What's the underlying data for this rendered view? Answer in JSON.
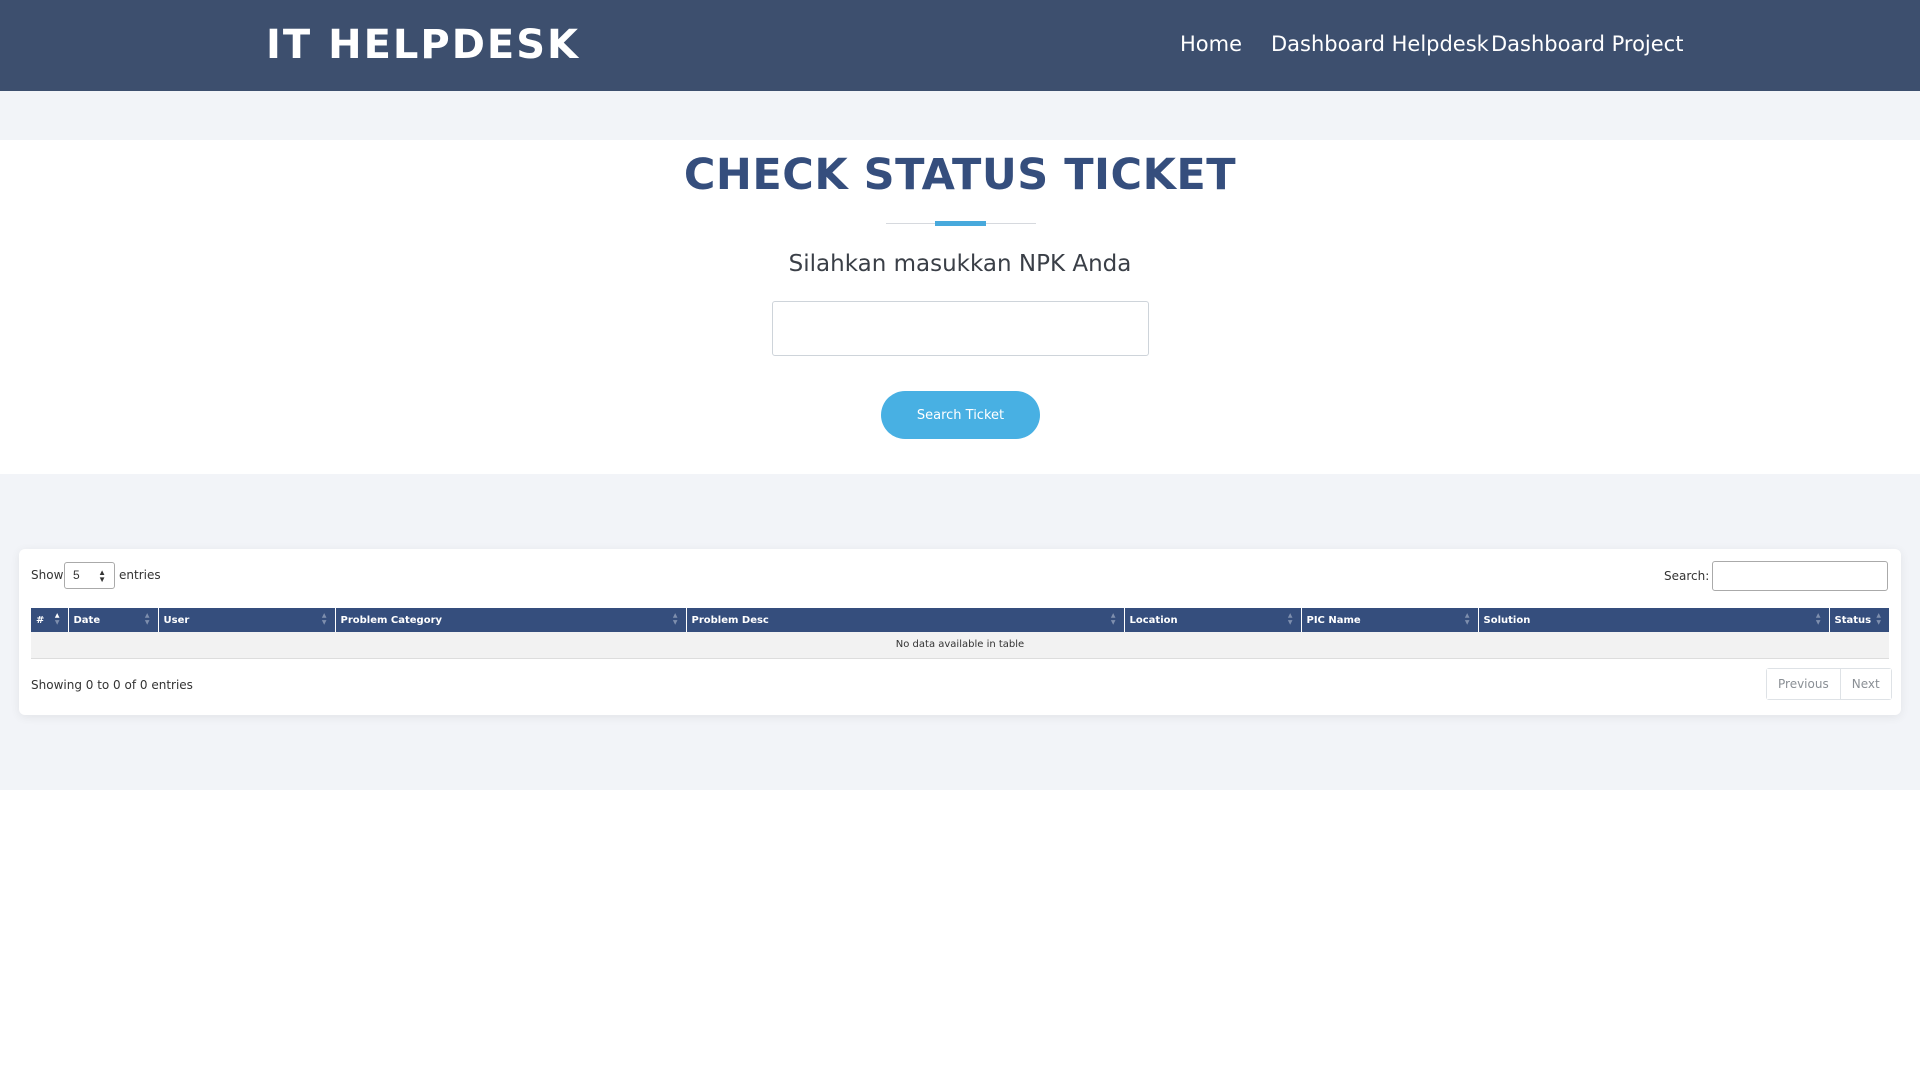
{
  "header": {
    "brand": "IT HELPDESK",
    "nav": [
      "Home",
      "Dashboard Helpdesk",
      "Dashboard Project"
    ]
  },
  "search_section": {
    "title": "CHECK STATUS TICKET",
    "subtitle": "Silahkan masukkan NPK Anda",
    "npk_value": "",
    "button_label": "Search Ticket"
  },
  "table": {
    "show_label": "Show",
    "page_length": "5",
    "entries_label": "entries",
    "search_label": "Search:",
    "search_value": "",
    "columns": [
      "#",
      "Date",
      "User",
      "Problem Category",
      "Problem Desc",
      "Location",
      "PIC Name",
      "Solution",
      "Status"
    ],
    "empty_message": "No data available in table",
    "info": "Showing 0 to 0 of 0 entries",
    "pagination": [
      "Previous",
      "Next"
    ]
  },
  "colors": {
    "header_bg": "#3d4f6e",
    "title": "#354e7d",
    "accent": "#48b0e3",
    "table_header": "#354e7d"
  }
}
